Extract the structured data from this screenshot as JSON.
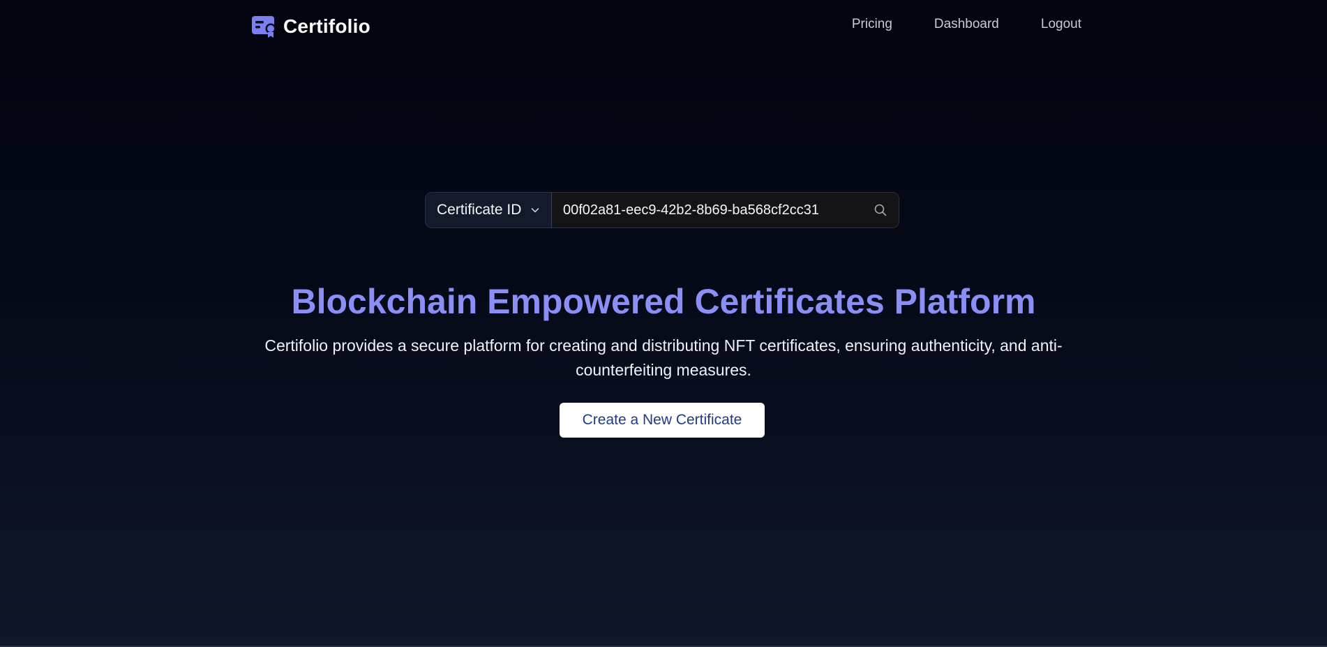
{
  "header": {
    "brand_name": "Certifolio",
    "logo_icon": "certificate-logo-icon",
    "nav": [
      {
        "label": "Pricing"
      },
      {
        "label": "Dashboard"
      },
      {
        "label": "Logout"
      }
    ]
  },
  "search": {
    "type_selected": "Certificate ID",
    "type_icon": "chevron-down-icon",
    "value": "00f02a81-eec9-42b2-8b69-ba568cf2cc31",
    "search_icon": "search-icon"
  },
  "hero": {
    "title": "Blockchain Empowered Certificates Platform",
    "description": "Certifolio provides a secure platform for creating and distributing NFT certificates, ensuring authenticity, and anti-counterfeiting measures.",
    "cta_label": "Create a New Certificate"
  },
  "colors": {
    "accent": "#8b8ef5",
    "cta_text": "#1e3a8a",
    "background": "#02040f"
  }
}
